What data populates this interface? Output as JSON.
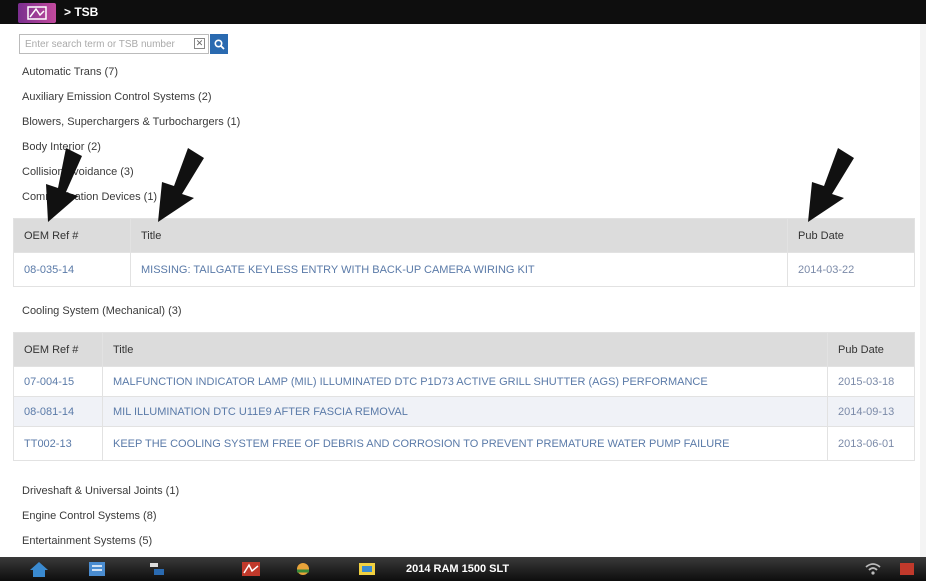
{
  "header": {
    "crumb": "> TSB"
  },
  "search": {
    "placeholder": "Enter search term or TSB number",
    "clear_glyph": "✕"
  },
  "categories_top": [
    "Automatic Trans (7)",
    "Auxiliary Emission Control Systems (2)",
    "Blowers, Superchargers & Turbochargers (1)",
    "Body Interior (2)",
    "Collision Avoidance (3)",
    "Communication Devices (1)"
  ],
  "table1": {
    "headers": [
      "OEM Ref #",
      "Title",
      "Pub Date"
    ],
    "rows": [
      {
        "ref": "08-035-14",
        "title": "MISSING: TAILGATE KEYLESS ENTRY WITH BACK-UP CAMERA WIRING KIT",
        "date": "2014-03-22"
      }
    ]
  },
  "cooling": {
    "label": "Cooling System (Mechanical) (3)"
  },
  "table2": {
    "headers": [
      "OEM Ref #",
      "Title",
      "Pub Date"
    ],
    "rows": [
      {
        "ref": "07-004-15",
        "title": "MALFUNCTION INDICATOR LAMP (MIL) ILLUMINATED DTC P1D73 ACTIVE GRILL SHUTTER (AGS) PERFORMANCE",
        "date": "2015-03-18"
      },
      {
        "ref": "08-081-14",
        "title": "MIL ILLUMINATION DTC U11E9 AFTER FASCIA REMOVAL",
        "date": "2014-09-13"
      },
      {
        "ref": "TT002-13",
        "title": "KEEP THE COOLING SYSTEM FREE OF DEBRIS AND CORROSION TO PREVENT PREMATURE WATER PUMP FAILURE",
        "date": "2013-06-01"
      }
    ]
  },
  "categories_bottom": [
    "Driveshaft & Universal Joints (1)",
    "Engine Control Systems (8)",
    "Entertainment Systems (5)"
  ],
  "taskbar": {
    "vehicle": "2014 RAM 1500 SLT"
  }
}
